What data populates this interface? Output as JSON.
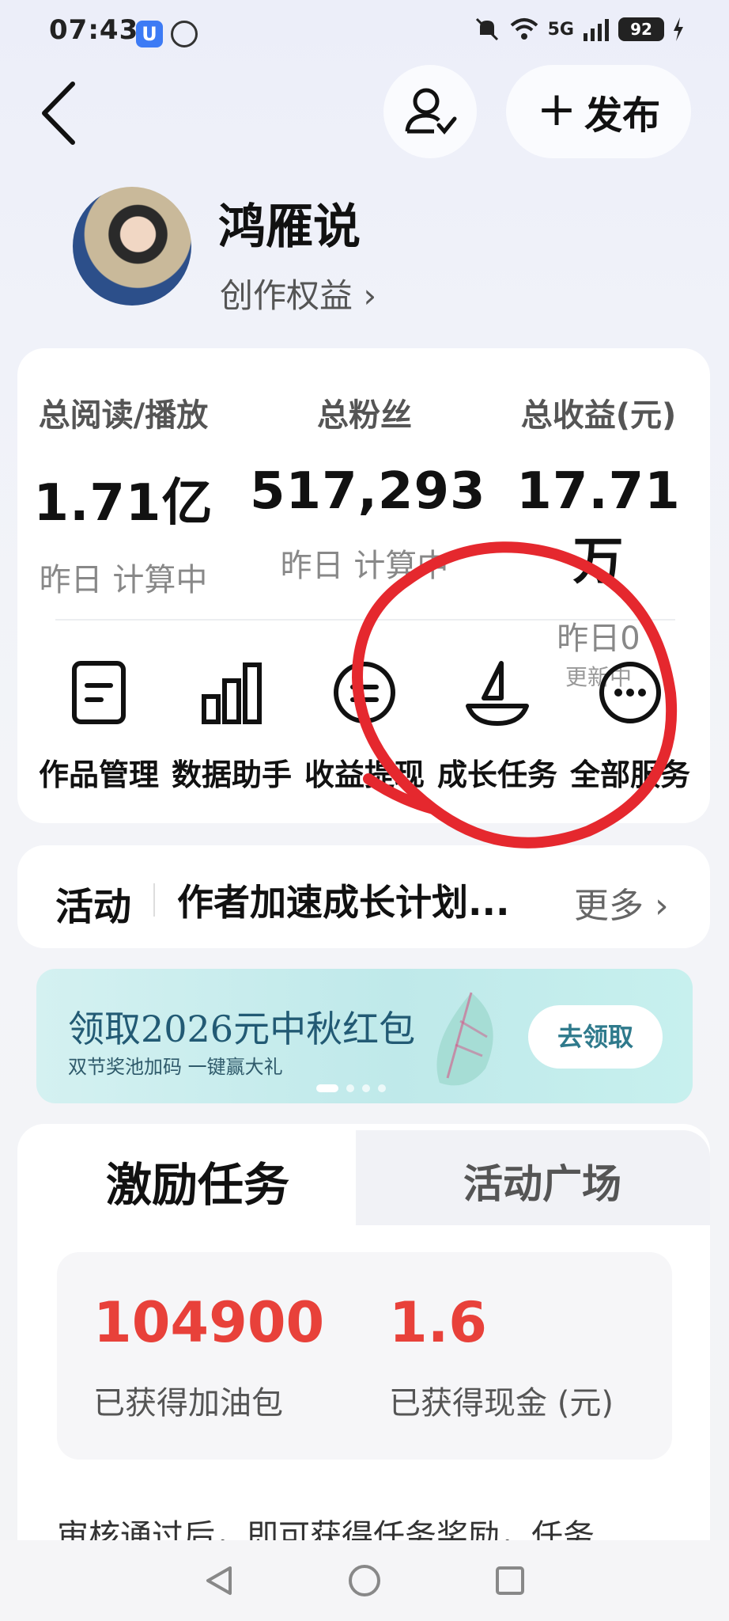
{
  "status_bar": {
    "time": "07:43",
    "app_badge": "U",
    "signal_label": "5G",
    "battery": "92"
  },
  "header": {
    "back_icon": "chevron-left-icon",
    "follow_icon": "user-check-icon",
    "publish_label": "发布"
  },
  "profile": {
    "name": "鸿雁说",
    "rights_link": "创作权益 ›"
  },
  "stats": [
    {
      "label": "总阅读/播放",
      "value": "1.71亿",
      "sub": "昨日 计算中"
    },
    {
      "label": "总粉丝",
      "value": "517,293",
      "sub": "昨日 计算中"
    },
    {
      "label": "总收益(元)",
      "value": "17.71万",
      "sub": "昨日0",
      "sub2": "更新中"
    }
  ],
  "services": [
    {
      "label": "作品管理",
      "icon": "document-icon"
    },
    {
      "label": "数据助手",
      "icon": "bar-chart-icon"
    },
    {
      "label": "收益提现",
      "icon": "coin-icon"
    },
    {
      "label": "成长任务",
      "icon": "sailboat-icon"
    },
    {
      "label": "全部服务",
      "icon": "more-icon"
    }
  ],
  "activity": {
    "title": "活动",
    "text": "作者加速成长计划...",
    "more": "更多 ›"
  },
  "banner": {
    "title": "领取2026元中秋红包",
    "subtitle": "双节奖池加码 一键赢大礼",
    "button": "去领取"
  },
  "tasks": {
    "tabs": [
      "激励任务",
      "活动广场"
    ],
    "rewards": [
      {
        "value": "104900",
        "label": "已获得加油包"
      },
      {
        "value": "1.6",
        "label": "已获得现金 (元)"
      }
    ],
    "description": "审核通过后，即可获得任务奖励，任务"
  },
  "colors": {
    "accent_red": "#e8413a",
    "annotation_red": "#e5282e",
    "banner_teal": "#bfe9ea"
  }
}
